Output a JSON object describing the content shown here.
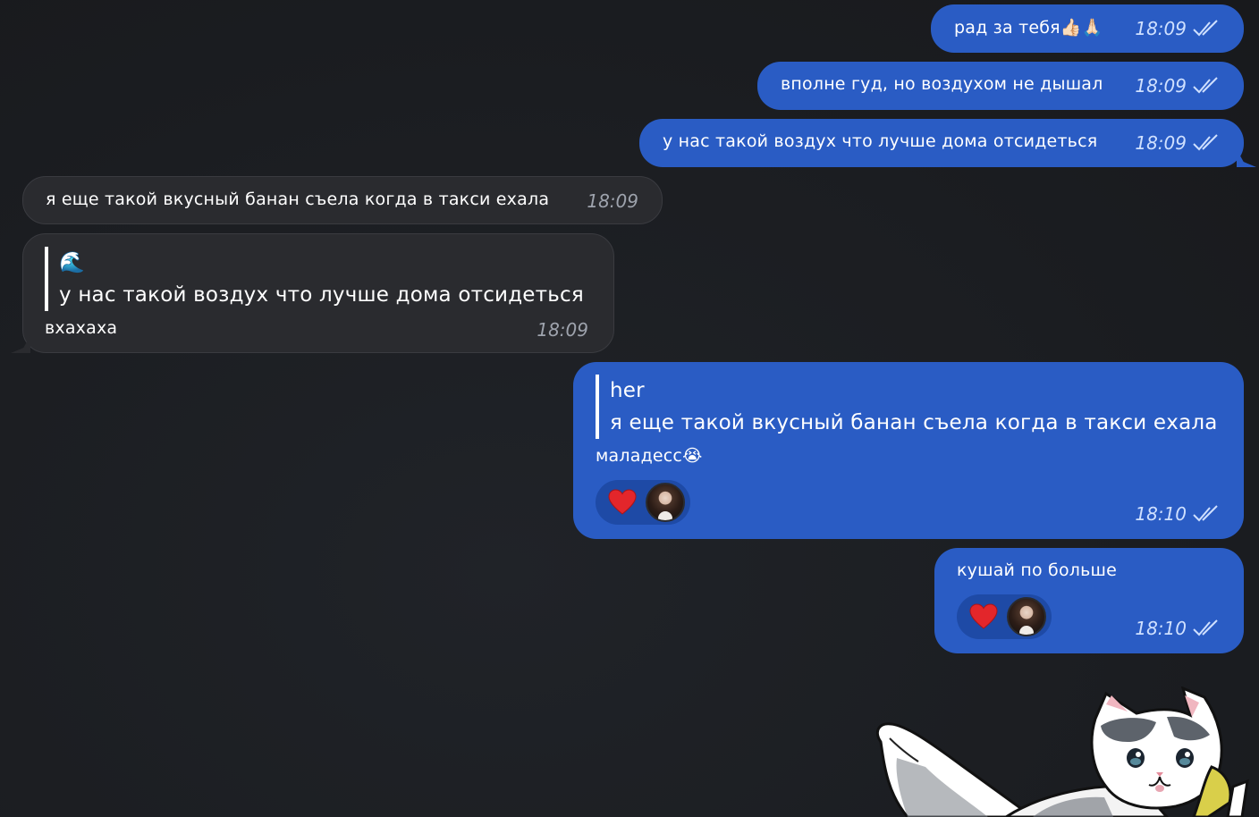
{
  "messages": [
    {
      "text": "рад за тебя👍🏻🙏🏻",
      "time": "18:09"
    },
    {
      "text": "вполне гуд, но воздухом не дышал",
      "time": "18:09"
    },
    {
      "text": "у нас такой воздух что лучше дома отсидеться",
      "time": "18:09"
    },
    {
      "text": "я еще такой вкусный банан съела когда в такси ехала",
      "time": "18:09"
    },
    {
      "reply_author": "🌊",
      "reply_text": "у нас такой воздух что лучше дома отсидеться",
      "text": "вхахаха",
      "time": "18:09"
    },
    {
      "reply_author": "her",
      "reply_text": "я еще такой вкусный банан съела когда в такси ехала",
      "text": "маладесс😭",
      "time": "18:10",
      "reactions": [
        "heart-icon",
        "avatar"
      ]
    },
    {
      "text": "кушай по больше",
      "time": "18:10",
      "reactions": [
        "heart-icon",
        "avatar"
      ]
    }
  ],
  "colors": {
    "background": "#1c1e22",
    "outgoing_bubble": "#2a5cc4",
    "incoming_bubble": "#2a2b2f"
  }
}
